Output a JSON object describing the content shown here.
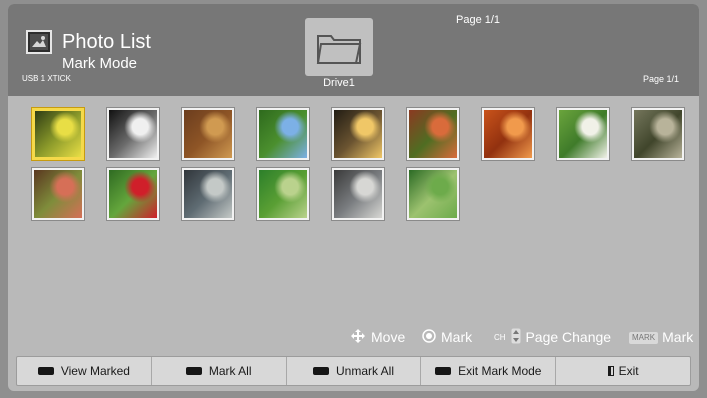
{
  "header": {
    "title": "Photo List",
    "subtitle": "Mark Mode",
    "device": "USB 1 XTICK",
    "folder_label": "Drive1",
    "page_top": "Page 1/1",
    "page_right": "Page 1/1",
    "app_icon": "photo-icon",
    "folder_icon": "folder-icon"
  },
  "thumbnails": [
    {
      "name": "yellow-butterfly",
      "colors": [
        "#2f3d14",
        "#e8de45",
        "#8b9a2a"
      ],
      "selected": true
    },
    {
      "name": "black-white-cat",
      "colors": [
        "#111111",
        "#f0f0f0",
        "#6b6b6b"
      ],
      "selected": false
    },
    {
      "name": "wooden-shelves",
      "colors": [
        "#6b3d1e",
        "#d09a51",
        "#8e5526"
      ],
      "selected": false
    },
    {
      "name": "blue-flowers",
      "colors": [
        "#2e6a1d",
        "#7cb0e6",
        "#4b8f2e"
      ],
      "selected": false
    },
    {
      "name": "sunset",
      "colors": [
        "#221d14",
        "#f0c767",
        "#6b5431"
      ],
      "selected": false
    },
    {
      "name": "fruits-leaves",
      "colors": [
        "#8b3a22",
        "#d96b3b",
        "#4f6d22"
      ],
      "selected": false
    },
    {
      "name": "oranges",
      "colors": [
        "#c9531b",
        "#f19a4c",
        "#92310f"
      ],
      "selected": false
    },
    {
      "name": "dandelion",
      "colors": [
        "#6aa43c",
        "#f1f1e8",
        "#3f7b2a"
      ],
      "selected": false
    },
    {
      "name": "lichen-stone",
      "colors": [
        "#74765c",
        "#b8b39a",
        "#40452b"
      ],
      "selected": false
    },
    {
      "name": "red-berries",
      "colors": [
        "#5a3720",
        "#d66f57",
        "#7f8d3b"
      ],
      "selected": false
    },
    {
      "name": "red-rose",
      "colors": [
        "#2f6b22",
        "#d01f2a",
        "#64a63c"
      ],
      "selected": false
    },
    {
      "name": "pot",
      "colors": [
        "#31363b",
        "#c4c9c7",
        "#5f6c73"
      ],
      "selected": false
    },
    {
      "name": "green-field",
      "colors": [
        "#2c7f2a",
        "#bad28d",
        "#5a9f34"
      ],
      "selected": false
    },
    {
      "name": "temple-hall",
      "colors": [
        "#3a3a3a",
        "#d7d7d4",
        "#7a7d80"
      ],
      "selected": false
    },
    {
      "name": "green-forest",
      "colors": [
        "#2c6b25",
        "#6dab4b",
        "#9cc26f"
      ],
      "selected": false
    }
  ],
  "help": [
    {
      "icon": "move-arrows-icon",
      "label": "Move"
    },
    {
      "icon": "mark-dot-icon",
      "label": "Mark"
    },
    {
      "icon": "ch-key-icon",
      "label": "Page Change",
      "badge": "CH"
    },
    {
      "icon": "mark-key-icon",
      "label": "Mark",
      "badge": "MARK"
    }
  ],
  "buttons": [
    {
      "label": "View Marked",
      "icon": "black-key-icon"
    },
    {
      "label": "Mark All",
      "icon": "black-key-icon"
    },
    {
      "label": "Unmark All",
      "icon": "black-key-icon"
    },
    {
      "label": "Exit Mark Mode",
      "icon": "black-key-icon"
    },
    {
      "label": "Exit",
      "icon": "exit-icon"
    }
  ],
  "colors": {
    "header_bg": "#777777",
    "content_bg": "#b9b9b9",
    "selection": "#f5d94a"
  }
}
